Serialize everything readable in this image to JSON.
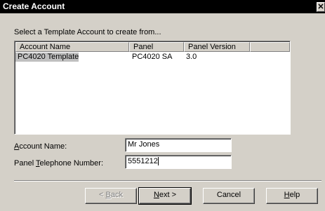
{
  "window": {
    "title": "Create Account",
    "close_glyph": "✕"
  },
  "prompt": "Select a Template Account to create from...",
  "list": {
    "columns": [
      "Account Name",
      "Panel",
      "Panel Version"
    ],
    "rows": [
      [
        "PC4020 Template",
        "PC4020 SA",
        "3.0"
      ]
    ],
    "selected_row": 0
  },
  "fields": {
    "account_name": {
      "label_prefix": "",
      "label_accel": "A",
      "label_rest": "ccount Name:",
      "value": "Mr Jones"
    },
    "telephone": {
      "label_prefix": "Panel ",
      "label_accel": "T",
      "label_rest": "elephone Number:",
      "value": "5551212"
    }
  },
  "buttons": {
    "back": {
      "prefix": "< ",
      "accel": "B",
      "rest": "ack",
      "enabled": false
    },
    "next": {
      "prefix": "",
      "accel": "N",
      "rest": "ext >",
      "enabled": true
    },
    "cancel": {
      "label": "Cancel"
    },
    "help": {
      "prefix": "",
      "accel": "H",
      "rest": "elp"
    }
  }
}
